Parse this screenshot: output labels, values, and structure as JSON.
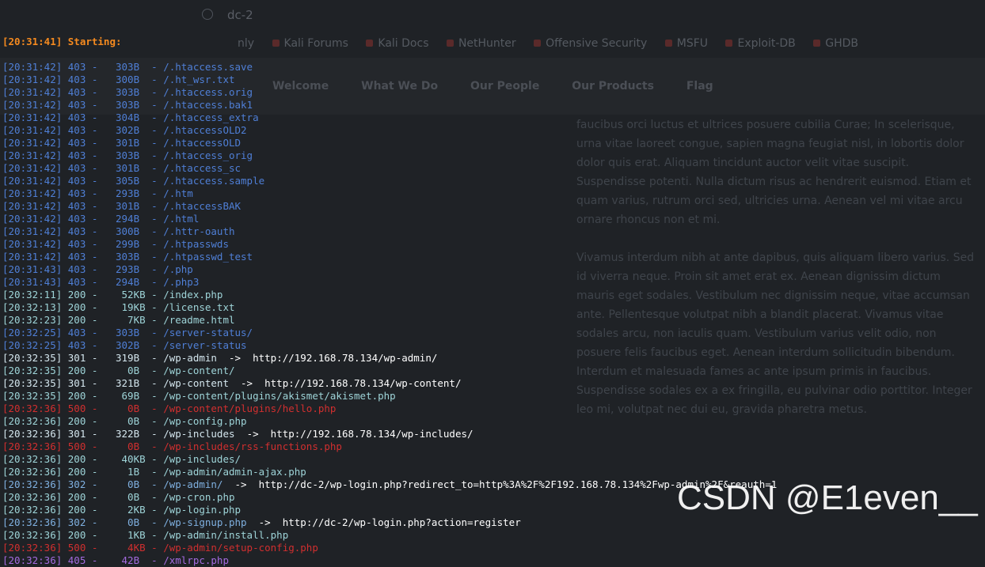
{
  "browser_bg": {
    "tab_title": "dc-2",
    "bookmarks": [
      "Kali Forums",
      "Kali Docs",
      "NetHunter",
      "Offensive Security",
      "MSFU",
      "Exploit-DB",
      "GHDB"
    ],
    "partial_label": "nly",
    "nav": [
      "Welcome",
      "What We Do",
      "Our People",
      "Our Products",
      "Flag"
    ],
    "paragraphs": [
      "faucibus orci luctus et ultrices posuere cubilia Curae; In scelerisque,\nurna vitae laoreet congue, sapien magna feugiat nisl, in lobortis dolor\ndolor quis erat. Aliquam tincidunt auctor velit vitae suscipit.\nSuspendisse potenti. Nulla dictum risus ac hendrerit euismod. Etiam et\nquam varius, rutrum orci sed, ultricies urna. Aenean vel mi vitae arcu\nornare rhoncus non et mi.",
      "Vivamus interdum nibh at ante dapibus, quis aliquam libero varius. Sed\nid viverra neque. Proin sit amet erat ex. Aenean dignissim dictum\nmauris eget sodales. Vestibulum nec dignissim neque, vitae accumsan\nante. Pellentesque volutpat nibh a blandit placerat. Vivamus vitae\nsodales arcu, non iaculis quam. Vestibulum varius velit odio, non\nposuere felis faucibus eget. Aenean interdum sollicitudin bibendum.\nInterdum et malesuada fames ac ante ipsum primis in faucibus.\nSuspendisse sodales ex a ex fringilla, eu pulvinar odio porttitor. Integer\nleo mi, volutpat nec dui eu, gravida pharetra metus."
    ]
  },
  "terminal": {
    "header": "[20:31:41] Starting:",
    "lines": [
      {
        "text": "[20:31:42] 403 -   303B  - /.htaccess.save",
        "status": "403",
        "redirect": ""
      },
      {
        "text": "[20:31:42] 403 -   300B  - /.ht_wsr.txt",
        "status": "403",
        "redirect": ""
      },
      {
        "text": "[20:31:42] 403 -   303B  - /.htaccess.orig",
        "status": "403",
        "redirect": ""
      },
      {
        "text": "[20:31:42] 403 -   303B  - /.htaccess.bak1",
        "status": "403",
        "redirect": ""
      },
      {
        "text": "[20:31:42] 403 -   304B  - /.htaccess_extra",
        "status": "403",
        "redirect": ""
      },
      {
        "text": "[20:31:42] 403 -   302B  - /.htaccessOLD2",
        "status": "403",
        "redirect": ""
      },
      {
        "text": "[20:31:42] 403 -   301B  - /.htaccessOLD",
        "status": "403",
        "redirect": ""
      },
      {
        "text": "[20:31:42] 403 -   303B  - /.htaccess_orig",
        "status": "403",
        "redirect": ""
      },
      {
        "text": "[20:31:42] 403 -   301B  - /.htaccess_sc",
        "status": "403",
        "redirect": ""
      },
      {
        "text": "[20:31:42] 403 -   305B  - /.htaccess.sample",
        "status": "403",
        "redirect": ""
      },
      {
        "text": "[20:31:42] 403 -   293B  - /.htm",
        "status": "403",
        "redirect": ""
      },
      {
        "text": "[20:31:42] 403 -   301B  - /.htaccessBAK",
        "status": "403",
        "redirect": ""
      },
      {
        "text": "[20:31:42] 403 -   294B  - /.html",
        "status": "403",
        "redirect": ""
      },
      {
        "text": "[20:31:42] 403 -   300B  - /.httr-oauth",
        "status": "403",
        "redirect": ""
      },
      {
        "text": "[20:31:42] 403 -   299B  - /.htpasswds",
        "status": "403",
        "redirect": ""
      },
      {
        "text": "[20:31:42] 403 -   303B  - /.htpasswd_test",
        "status": "403",
        "redirect": ""
      },
      {
        "text": "[20:31:43] 403 -   293B  - /.php",
        "status": "403",
        "redirect": ""
      },
      {
        "text": "[20:31:43] 403 -   294B  - /.php3",
        "status": "403",
        "redirect": ""
      },
      {
        "text": "[20:32:11] 200 -    52KB - /index.php",
        "status": "200",
        "redirect": ""
      },
      {
        "text": "[20:32:13] 200 -    19KB - /license.txt",
        "status": "200",
        "redirect": ""
      },
      {
        "text": "[20:32:23] 200 -     7KB - /readme.html",
        "status": "200",
        "redirect": ""
      },
      {
        "text": "[20:32:25] 403 -   303B  - /server-status/",
        "status": "403",
        "redirect": ""
      },
      {
        "text": "[20:32:25] 403 -   302B  - /server-status",
        "status": "403",
        "redirect": ""
      },
      {
        "text": "[20:32:35] 301 -   319B  - /wp-admin  ",
        "status": "301",
        "redirect": "->  http://192.168.78.134/wp-admin/"
      },
      {
        "text": "[20:32:35] 200 -     0B  - /wp-content/",
        "status": "200",
        "redirect": ""
      },
      {
        "text": "[20:32:35] 301 -   321B  - /wp-content  ",
        "status": "301",
        "redirect": "->  http://192.168.78.134/wp-content/"
      },
      {
        "text": "[20:32:35] 200 -    69B  - /wp-content/plugins/akismet/akismet.php",
        "status": "200",
        "redirect": ""
      },
      {
        "text": "[20:32:36] 500 -     0B  - /wp-content/plugins/hello.php",
        "status": "500",
        "redirect": ""
      },
      {
        "text": "[20:32:36] 200 -     0B  - /wp-config.php",
        "status": "200",
        "redirect": ""
      },
      {
        "text": "[20:32:36] 301 -   322B  - /wp-includes  ",
        "status": "301",
        "redirect": "->  http://192.168.78.134/wp-includes/"
      },
      {
        "text": "[20:32:36] 500 -     0B  - /wp-includes/rss-functions.php",
        "status": "500",
        "redirect": ""
      },
      {
        "text": "[20:32:36] 200 -    40KB - /wp-includes/",
        "status": "200",
        "redirect": ""
      },
      {
        "text": "[20:32:36] 200 -     1B  - /wp-admin/admin-ajax.php",
        "status": "200",
        "redirect": ""
      },
      {
        "text": "[20:32:36] 302 -     0B  - /wp-admin/  ",
        "status": "302",
        "redirect": "->  http://dc-2/wp-login.php?redirect_to=http%3A%2F%2F192.168.78.134%2Fwp-admin%2F&reauth=1"
      },
      {
        "text": "[20:32:36] 200 -     0B  - /wp-cron.php",
        "status": "200",
        "redirect": ""
      },
      {
        "text": "[20:32:36] 200 -     2KB - /wp-login.php",
        "status": "200",
        "redirect": ""
      },
      {
        "text": "[20:32:36] 302 -     0B  - /wp-signup.php  ",
        "status": "302",
        "redirect": "->  http://dc-2/wp-login.php?action=register"
      },
      {
        "text": "[20:32:36] 200 -     1KB - /wp-admin/install.php",
        "status": "200",
        "redirect": ""
      },
      {
        "text": "[20:32:36] 500 -     4KB - /wp-admin/setup-config.php",
        "status": "500",
        "redirect": ""
      },
      {
        "text": "[20:32:36] 405 -    42B  - /xmlrpc.php",
        "status": "405",
        "redirect": ""
      }
    ]
  },
  "watermark": "CSDN @E1even__",
  "colors": {
    "starting": "#f58a1f",
    "s403": "#4f7fd6",
    "s200": "#9ed4d8",
    "s301": "#d4e6ee",
    "s302": "#7fb0e0",
    "s500": "#d12f2f",
    "s405": "#a46be0"
  }
}
